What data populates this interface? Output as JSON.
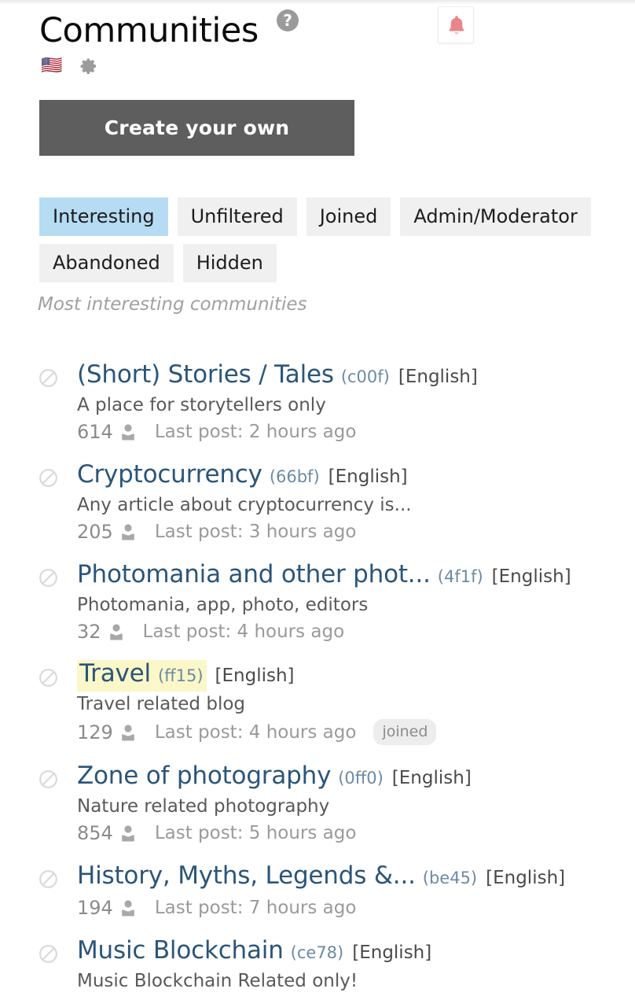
{
  "header": {
    "title": "Communities",
    "help_icon": "question-mark-circle-icon",
    "bell_icon": "notification-bell-icon",
    "flag_icon": "🇺🇸",
    "gear_icon": "settings-gear-icon",
    "bell_color": "#e8868a"
  },
  "create_button": {
    "label": "Create your own",
    "background": "#5e5e5e"
  },
  "tabs": {
    "active_index": 0,
    "active_color": "#b5dcf3",
    "inactive_color": "#f0f0f0",
    "items": [
      {
        "label": "Interesting"
      },
      {
        "label": "Unfiltered"
      },
      {
        "label": "Joined"
      },
      {
        "label": "Admin/Moderator"
      },
      {
        "label": "Abandoned"
      },
      {
        "label": "Hidden"
      }
    ]
  },
  "section_caption": "Most interesting communities",
  "list": {
    "items": [
      {
        "block_icon": "block-circle-icon",
        "title": "(Short) Stories / Tales",
        "hash": "(c00f)",
        "language": "[English]",
        "description": "A place for storytellers only",
        "members": "614",
        "member_icon": "user-icon",
        "last_post": "Last post: 2 hours ago",
        "joined": "",
        "highlighted": false
      },
      {
        "block_icon": "block-circle-icon",
        "title": "Cryptocurrency",
        "hash": "(66bf)",
        "language": "[English]",
        "description": "Any article about cryptocurrency is...",
        "members": "205",
        "member_icon": "user-icon",
        "last_post": "Last post: 3 hours ago",
        "joined": "",
        "highlighted": false
      },
      {
        "block_icon": "block-circle-icon",
        "title": "Photomania and other phot...",
        "hash": "(4f1f)",
        "language": "[English]",
        "description": "Photomania, app, photo, editors",
        "members": "32",
        "member_icon": "user-icon",
        "last_post": "Last post: 4 hours ago",
        "joined": "",
        "highlighted": false
      },
      {
        "block_icon": "block-circle-icon",
        "title": "Travel",
        "hash": "(ff15)",
        "language": "[English]",
        "description": "Travel related blog",
        "members": "129",
        "member_icon": "user-icon",
        "last_post": "Last post: 4 hours ago",
        "joined": "joined",
        "highlighted": true,
        "highlight_color": "#faf8c8"
      },
      {
        "block_icon": "block-circle-icon",
        "title": "Zone of photography",
        "hash": "(0ff0)",
        "language": "[English]",
        "description": "Nature related photography",
        "members": "854",
        "member_icon": "user-icon",
        "last_post": "Last post: 5 hours ago",
        "joined": "",
        "highlighted": false
      },
      {
        "block_icon": "block-circle-icon",
        "title": "History, Myths, Legends &...",
        "hash": "(be45)",
        "language": "[English]",
        "description": "",
        "members": "194",
        "member_icon": "user-icon",
        "last_post": "Last post: 7 hours ago",
        "joined": "",
        "highlighted": false
      },
      {
        "block_icon": "block-circle-icon",
        "title": "Music Blockchain",
        "hash": "(ce78)",
        "language": "[English]",
        "description": "Music Blockchain Related only!",
        "members": "",
        "member_icon": "user-icon",
        "last_post": "",
        "joined": "",
        "highlighted": false
      }
    ]
  }
}
